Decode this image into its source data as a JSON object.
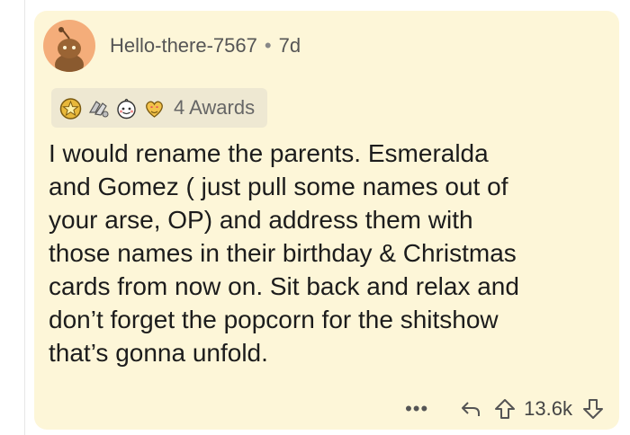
{
  "comment": {
    "author": "Hello-there-7567",
    "separator": "•",
    "age": "7d",
    "awards_label": "4 Awards",
    "award_icons": [
      "gold-star-award-icon",
      "silver-hands-award-icon",
      "wholesome-face-award-icon",
      "heart-eyes-award-icon"
    ],
    "body": "I would rename the parents. Esmeralda\nand Gomez ( just pull some names out of\nyour arse, OP) and address them with\nthose names in their birthday & Christmas\ncards from now on. Sit back and relax and\ndon’t forget the popcorn for the shitshow\nthat’s gonna unfold.",
    "more_label": "•••",
    "score": "13.6k"
  },
  "colors": {
    "card_background": "#fdf6d8",
    "avatar_background": "#f4ad7a",
    "awards_background": "#eee8d2"
  }
}
